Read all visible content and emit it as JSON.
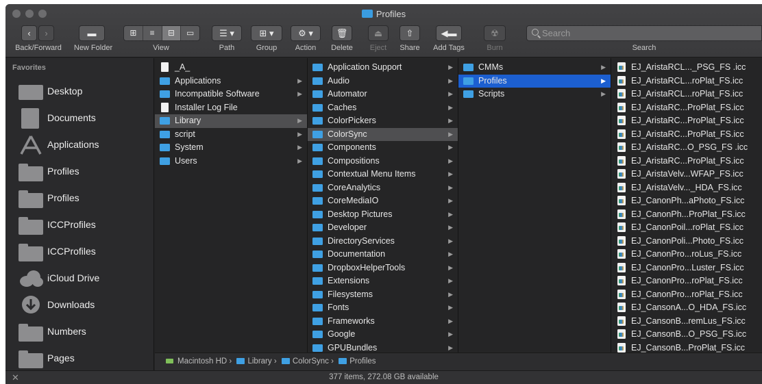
{
  "window": {
    "title": "Profiles"
  },
  "toolbar": {
    "back_forward_label": "Back/Forward",
    "new_folder_label": "New Folder",
    "view_label": "View",
    "path_label": "Path",
    "group_label": "Group",
    "action_label": "Action",
    "delete_label": "Delete",
    "eject_label": "Eject",
    "share_label": "Share",
    "add_tags_label": "Add Tags",
    "burn_label": "Burn",
    "search_label": "Search",
    "search_placeholder": "Search"
  },
  "sidebar": {
    "header": "Favorites",
    "items": [
      {
        "label": "Desktop",
        "icon": "desktop-icon"
      },
      {
        "label": "Documents",
        "icon": "documents-icon"
      },
      {
        "label": "Applications",
        "icon": "applications-icon"
      },
      {
        "label": "Profiles",
        "icon": "folder-icon"
      },
      {
        "label": "Profiles",
        "icon": "folder-icon"
      },
      {
        "label": "ICCProfiles",
        "icon": "folder-icon"
      },
      {
        "label": "ICCProfiles",
        "icon": "folder-icon"
      },
      {
        "label": "iCloud Drive",
        "icon": "icloud-icon"
      },
      {
        "label": "Downloads",
        "icon": "downloads-icon"
      },
      {
        "label": "Numbers",
        "icon": "folder-icon"
      },
      {
        "label": "Pages",
        "icon": "folder-icon"
      }
    ]
  },
  "columns": {
    "col1": [
      {
        "label": "_A_",
        "type": "doc"
      },
      {
        "label": "Applications",
        "type": "folder",
        "arrow": true
      },
      {
        "label": "Incompatible Software",
        "type": "folder",
        "arrow": true
      },
      {
        "label": "Installer Log File",
        "type": "doc"
      },
      {
        "label": "Library",
        "type": "folder",
        "arrow": true,
        "selected": "gray"
      },
      {
        "label": "script",
        "type": "folder",
        "arrow": true
      },
      {
        "label": "System",
        "type": "folder",
        "arrow": true
      },
      {
        "label": "Users",
        "type": "folder",
        "arrow": true
      }
    ],
    "col2": [
      {
        "label": "Application Support",
        "type": "folder",
        "arrow": true
      },
      {
        "label": "Audio",
        "type": "folder",
        "arrow": true
      },
      {
        "label": "Automator",
        "type": "folder",
        "arrow": true
      },
      {
        "label": "Caches",
        "type": "folder",
        "arrow": true
      },
      {
        "label": "ColorPickers",
        "type": "folder",
        "arrow": true
      },
      {
        "label": "ColorSync",
        "type": "folder",
        "arrow": true,
        "selected": "gray"
      },
      {
        "label": "Components",
        "type": "folder",
        "arrow": true
      },
      {
        "label": "Compositions",
        "type": "folder",
        "arrow": true
      },
      {
        "label": "Contextual Menu Items",
        "type": "folder",
        "arrow": true
      },
      {
        "label": "CoreAnalytics",
        "type": "folder",
        "arrow": true
      },
      {
        "label": "CoreMediaIO",
        "type": "folder",
        "arrow": true
      },
      {
        "label": "Desktop Pictures",
        "type": "folder",
        "arrow": true
      },
      {
        "label": "Developer",
        "type": "folder",
        "arrow": true
      },
      {
        "label": "DirectoryServices",
        "type": "folder",
        "arrow": true
      },
      {
        "label": "Documentation",
        "type": "folder",
        "arrow": true
      },
      {
        "label": "DropboxHelperTools",
        "type": "folder",
        "arrow": true
      },
      {
        "label": "Extensions",
        "type": "folder",
        "arrow": true
      },
      {
        "label": "Filesystems",
        "type": "folder",
        "arrow": true
      },
      {
        "label": "Fonts",
        "type": "folder",
        "arrow": true
      },
      {
        "label": "Frameworks",
        "type": "folder",
        "arrow": true
      },
      {
        "label": "Google",
        "type": "folder",
        "arrow": true
      },
      {
        "label": "GPUBundles",
        "type": "folder",
        "arrow": true
      }
    ],
    "col3": [
      {
        "label": "CMMs",
        "type": "folder",
        "arrow": true
      },
      {
        "label": "Profiles",
        "type": "folder",
        "arrow": true,
        "selected": "blue"
      },
      {
        "label": "Scripts",
        "type": "folder",
        "arrow": true
      }
    ],
    "col4": [
      {
        "label": "EJ_AristaRCL..._PSG_FS .icc",
        "type": "icc"
      },
      {
        "label": "EJ_AristaRCL...roPlat_FS.icc",
        "type": "icc"
      },
      {
        "label": "EJ_AristaRCL...roPlat_FS.icc",
        "type": "icc"
      },
      {
        "label": "EJ_AristaRC...ProPlat_FS.icc",
        "type": "icc"
      },
      {
        "label": "EJ_AristaRC...ProPlat_FS.icc",
        "type": "icc"
      },
      {
        "label": "EJ_AristaRC...ProPlat_FS.icc",
        "type": "icc"
      },
      {
        "label": "EJ_AristaRC...O_PSG_FS .icc",
        "type": "icc"
      },
      {
        "label": "EJ_AristaRC...ProPlat_FS.icc",
        "type": "icc"
      },
      {
        "label": "EJ_AristaVelv...WFAP_FS.icc",
        "type": "icc"
      },
      {
        "label": "EJ_AristaVelv..._HDA_FS.icc",
        "type": "icc"
      },
      {
        "label": "EJ_CanonPh...aPhoto_FS.icc",
        "type": "icc"
      },
      {
        "label": "EJ_CanonPh...ProPlat_FS.icc",
        "type": "icc"
      },
      {
        "label": "EJ_CanonPoil...roPlat_FS.icc",
        "type": "icc"
      },
      {
        "label": "EJ_CanonPoli...Photo_FS.icc",
        "type": "icc"
      },
      {
        "label": "EJ_CanonPro...roLus_FS.icc",
        "type": "icc"
      },
      {
        "label": "EJ_CanonPro...Luster_FS.icc",
        "type": "icc"
      },
      {
        "label": "EJ_CanonPro...roPlat_FS.icc",
        "type": "icc"
      },
      {
        "label": "EJ_CanonPro...roPlat_FS.icc",
        "type": "icc"
      },
      {
        "label": "EJ_CansonA...O_HDA_FS.icc",
        "type": "icc"
      },
      {
        "label": "EJ_CansonB...remLus_FS.icc",
        "type": "icc"
      },
      {
        "label": "EJ_CansonB...O_PSG_FS.icc",
        "type": "icc"
      },
      {
        "label": "EJ_CansonB...ProPlat_FS.icc",
        "type": "icc"
      }
    ]
  },
  "pathbar": {
    "items": [
      "Macintosh HD",
      "Library",
      "ColorSync",
      "Profiles"
    ],
    "separator": "›"
  },
  "status": {
    "text": "377 items, 272.08 GB available"
  },
  "colors": {
    "selection_blue": "#1c5fd0",
    "folder_blue": "#3fa0e3"
  }
}
